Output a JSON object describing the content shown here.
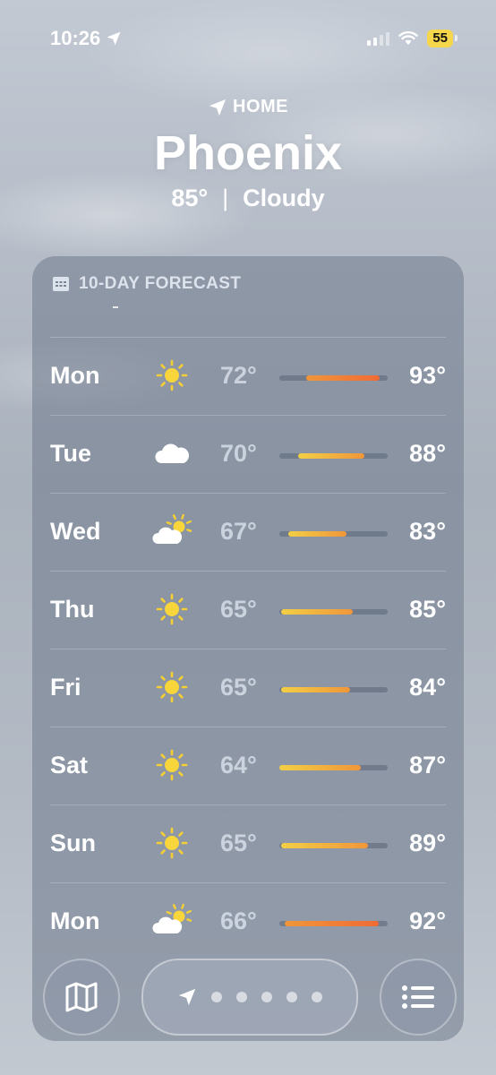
{
  "status_bar": {
    "time": "10:26",
    "battery": "55"
  },
  "header": {
    "location_label": "HOME",
    "city": "Phoenix",
    "current_temp": "85°",
    "separator": "|",
    "condition": "Cloudy"
  },
  "forecast": {
    "title": "10-DAY FORECAST",
    "days": [
      {
        "day": "Mon",
        "icon": "sun-icon",
        "low": "72°",
        "high": "93°",
        "bar_start": 0.25,
        "bar_end": 0.93
      },
      {
        "day": "Tue",
        "icon": "cloud-icon",
        "low": "70°",
        "high": "88°",
        "bar_start": 0.17,
        "bar_end": 0.78
      },
      {
        "day": "Wed",
        "icon": "partly-cloudy-icon",
        "low": "67°",
        "high": "83°",
        "bar_start": 0.08,
        "bar_end": 0.62
      },
      {
        "day": "Thu",
        "icon": "sun-icon",
        "low": "65°",
        "high": "85°",
        "bar_start": 0.02,
        "bar_end": 0.68
      },
      {
        "day": "Fri",
        "icon": "sun-icon",
        "low": "65°",
        "high": "84°",
        "bar_start": 0.02,
        "bar_end": 0.66
      },
      {
        "day": "Sat",
        "icon": "sun-icon",
        "low": "64°",
        "high": "87°",
        "bar_start": 0.0,
        "bar_end": 0.75
      },
      {
        "day": "Sun",
        "icon": "sun-icon",
        "low": "65°",
        "high": "89°",
        "bar_start": 0.02,
        "bar_end": 0.82
      },
      {
        "day": "Mon",
        "icon": "partly-cloudy-icon",
        "low": "66°",
        "high": "92°",
        "bar_start": 0.05,
        "bar_end": 0.92
      }
    ]
  },
  "colors": {
    "bar_cool": "#f2cf45",
    "bar_warm": "#f0963a",
    "bar_hot": "#ef6b35"
  },
  "toolbar": {
    "pager_dots": 5
  }
}
